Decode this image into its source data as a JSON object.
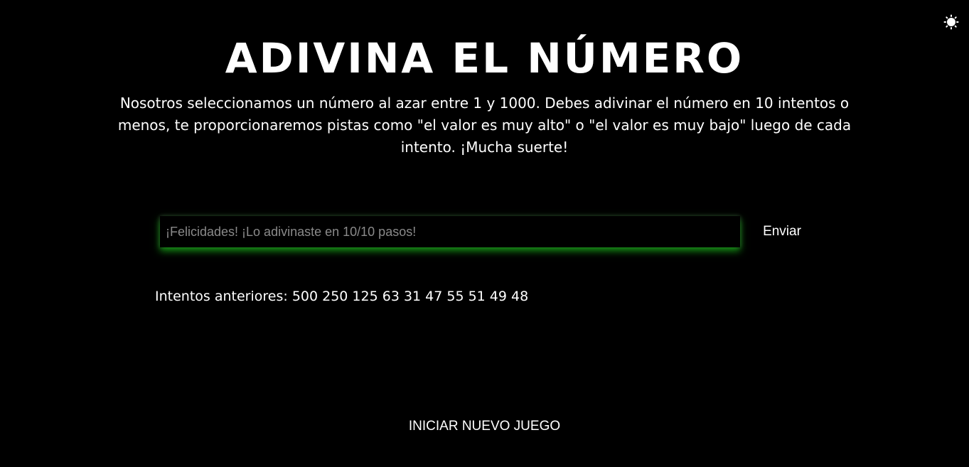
{
  "header": {
    "title": "ADIVINA EL NÚMERO",
    "description": "Nosotros seleccionamos un número al azar entre 1 y 1000. Debes adivinar el número en 10 intentos o menos, te proporcionaremos pistas como \"el valor es muy alto\" o \"el valor es muy bajo\" luego de cada intento. ¡Mucha suerte!"
  },
  "theme_toggle": {
    "icon": "sun-icon"
  },
  "form": {
    "input_placeholder": "¡Felicidades! ¡Lo adivinaste en 10/10 pasos!",
    "input_value": "",
    "submit_label": "Enviar"
  },
  "previous": {
    "label": "Intentos anteriores:",
    "guesses": "500 250 125 63 31 47 55 51 49 48"
  },
  "actions": {
    "new_game_label": "INICIAR NUEVO JUEGO"
  },
  "colors": {
    "background": "#000000",
    "text": "#ffffff",
    "input_glow": "#16aa16"
  }
}
